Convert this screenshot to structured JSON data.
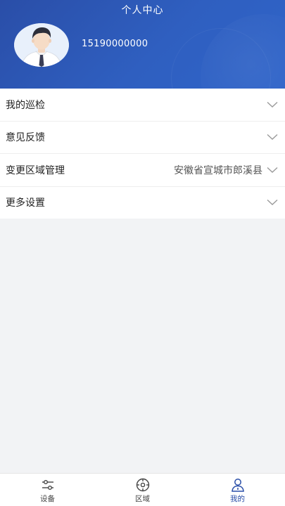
{
  "header": {
    "title": "个人中心",
    "phone": "15190000000"
  },
  "menu": {
    "items": [
      {
        "label": "我的巡检",
        "value": ""
      },
      {
        "label": "意见反馈",
        "value": ""
      },
      {
        "label": "变更区域管理",
        "value": "安徽省宣城市郎溪县"
      },
      {
        "label": "更多设置",
        "value": ""
      }
    ]
  },
  "tabbar": {
    "tabs": [
      {
        "label": "设备",
        "icon": "sliders-icon"
      },
      {
        "label": "区域",
        "icon": "target-icon"
      },
      {
        "label": "我的",
        "icon": "user-icon"
      }
    ],
    "active_index": 2
  },
  "colors": {
    "primary": "#2a4ea8",
    "header_gradient_end": "#2f64c9",
    "background": "#f2f3f5"
  }
}
